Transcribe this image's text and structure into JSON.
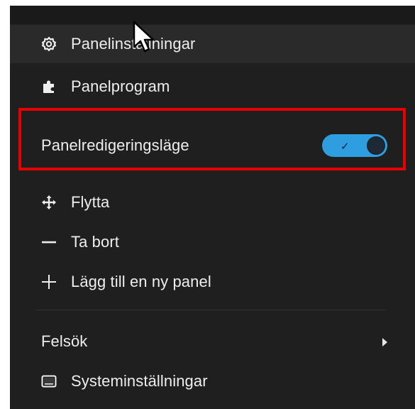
{
  "menu": {
    "items": [
      {
        "label": "Panelinställningar",
        "icon": "gear-icon"
      },
      {
        "label": "Panelprogram",
        "icon": "puzzle-icon"
      },
      {
        "label": "Panelredigeringsläge",
        "toggle_on": true
      },
      {
        "label": "Flytta",
        "icon": "move-icon"
      },
      {
        "label": "Ta bort",
        "icon": "minus-icon"
      },
      {
        "label": "Lägg till en ny panel",
        "icon": "plus-icon"
      },
      {
        "label": "Felsök",
        "icon": "chevron-right-icon"
      },
      {
        "label": "Systeminställningar",
        "icon": "display-icon"
      }
    ]
  },
  "colors": {
    "menu_bg": "#1f1f1f",
    "toggle_accent": "#2f9ee0",
    "highlight_border": "#e60000"
  }
}
